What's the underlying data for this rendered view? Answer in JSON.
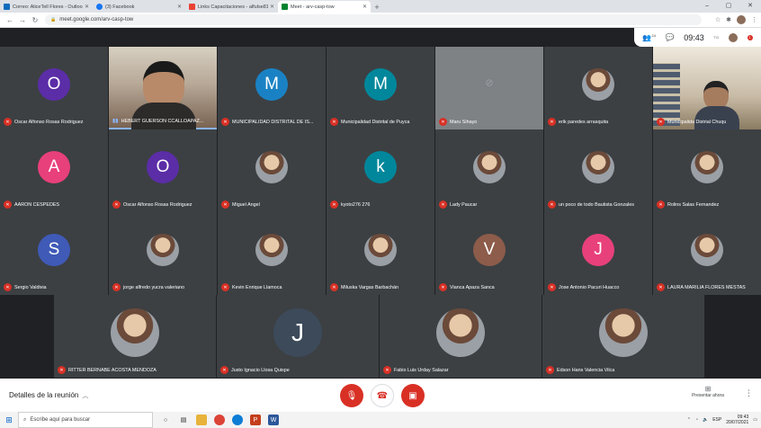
{
  "browser": {
    "tabs": [
      {
        "title": "Correo: AliceTell Flores - Outlook",
        "favicon_color": "#0f6cbd",
        "active": false
      },
      {
        "title": "(3) Facebook",
        "favicon_color": "#1877f2",
        "active": false
      },
      {
        "title": "Links Capacitaciones - alfulse818",
        "favicon_color": "#ea4335",
        "active": false
      },
      {
        "title": "Meet - arv-casp-tow",
        "favicon_color": "#00832d",
        "active": true
      }
    ],
    "new_tab": "+",
    "window_controls": [
      "–",
      "▢",
      "✕"
    ],
    "url": "meet.google.com/arv-casp-tow",
    "nav": {
      "back": "←",
      "forward": "→",
      "reload": "↻"
    }
  },
  "meet_info": {
    "participants_count": "24",
    "time": "09:43",
    "user_initials": "TG",
    "notification_count": "1"
  },
  "participants": [
    {
      "name": "Oscar Alfonso Rosas Rodriguez",
      "initial": "O",
      "color": "#5b2da7"
    },
    {
      "name": "HEBERT GUERSON CCALLOAPAZ...",
      "speaking": true,
      "video": "video"
    },
    {
      "name": "MUNICIPALIDAD DISTRITAL DE IS...",
      "initial": "M",
      "color": "#1a82c4"
    },
    {
      "name": "Municipalidad Distrital de Puyca",
      "initial": "M",
      "color": "#00879b"
    },
    {
      "name": "Maru Sihayo",
      "camera_off": true
    },
    {
      "name": "erik paredes arrasquita",
      "photo": true
    },
    {
      "name": "Municipalida Distrial Chuqu",
      "video": "video2"
    },
    {
      "name": "AARON CESPEDES",
      "initial": "A",
      "color": "#e8407a"
    },
    {
      "name": "Oscar Alfonso Rosas Rodriguez",
      "initial": "O",
      "color": "#5b2da7"
    },
    {
      "name": "Miguel Angel",
      "photo": true
    },
    {
      "name": "kyoto276 276",
      "initial": "k",
      "color": "#00879b"
    },
    {
      "name": "Lady Paucar",
      "photo": true
    },
    {
      "name": "un poco de todo Bautista Gonzales",
      "photo": true
    },
    {
      "name": "Rolins Salas Fernandez",
      "photo": true
    },
    {
      "name": "Sergio Valdivia",
      "initial": "S",
      "color": "#3f5ab7"
    },
    {
      "name": "jorge alfredo yucra valeriano",
      "photo": true
    },
    {
      "name": "Kevin Enrique Llamoca",
      "photo": true
    },
    {
      "name": "Miluska Vargas Barbachán",
      "photo": true
    },
    {
      "name": "Vianca Apaza Sanca",
      "initial": "V",
      "color": "#8d5c4a"
    },
    {
      "name": "Jose Antonio Pacuri Huacco",
      "initial": "J",
      "color": "#e8407a"
    },
    {
      "name": "LAURA MARILIA FLORES MESTAS",
      "photo": true
    },
    {
      "name": "RITTER BERNABE ACOSTA MENDOZA",
      "photo": true
    },
    {
      "name": "Justo Ignacio Llosa Quispe",
      "initial": "J",
      "color": "#3c4a5a"
    },
    {
      "name": "Fabio Luis Urday Salazar",
      "photo": true
    },
    {
      "name": "Edson Hans Valencia Vilca",
      "photo": true
    }
  ],
  "bottom_bar": {
    "meeting_details": "Detalles de la reunión",
    "present_now": "Presentar ahora"
  },
  "taskbar": {
    "search_placeholder": "Escribe aquí para buscar",
    "language": "ESP",
    "time": "09:43",
    "date": "20/07/2021"
  }
}
